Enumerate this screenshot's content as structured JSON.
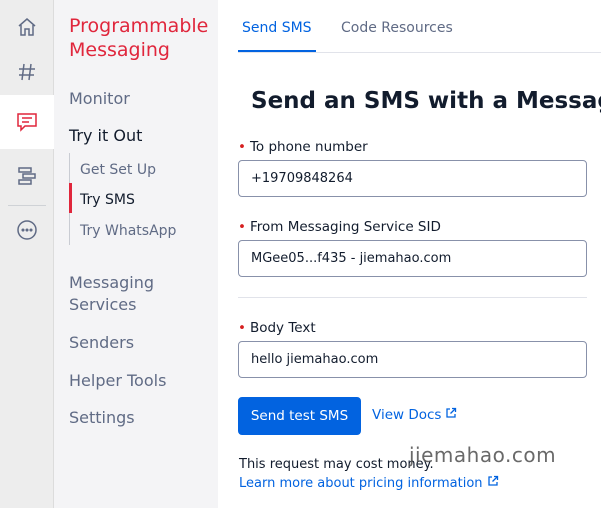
{
  "rail": {
    "items": [
      {
        "icon": "home-icon"
      },
      {
        "icon": "hash-icon"
      },
      {
        "icon": "message-icon",
        "active": true
      },
      {
        "icon": "flow-icon"
      },
      {
        "icon": "more-icon"
      }
    ]
  },
  "sidebar": {
    "product_title": "Programmable Messaging",
    "monitor": "Monitor",
    "try_it_out": "Try it Out",
    "sub_items": [
      "Get Set Up",
      "Try SMS",
      "Try WhatsApp"
    ],
    "messaging_services": "Messaging Services",
    "senders": "Senders",
    "helper_tools": "Helper Tools",
    "settings": "Settings"
  },
  "tabs": {
    "send_sms": "Send SMS",
    "code_resources": "Code Resources"
  },
  "main": {
    "heading": "Send an SMS with a Messaging Service",
    "required_mark": "•",
    "to_label": "To phone number",
    "to_value": "+19709848264",
    "from_label": "From Messaging Service SID",
    "from_value": "MGee05...f435 - jiemahao.com",
    "body_label": "Body Text",
    "body_value": "hello jiemahao.com",
    "send_button": "Send test SMS",
    "view_docs": "View Docs",
    "cost_note": "This request may cost money.",
    "pricing_link": "Learn more about pricing information"
  },
  "watermark": "jiemahao.com",
  "colors": {
    "brand_red": "#e0263c",
    "link_blue": "#0263e0",
    "rail_bg": "#ededed",
    "subnav_bg": "#f4f4f6"
  }
}
